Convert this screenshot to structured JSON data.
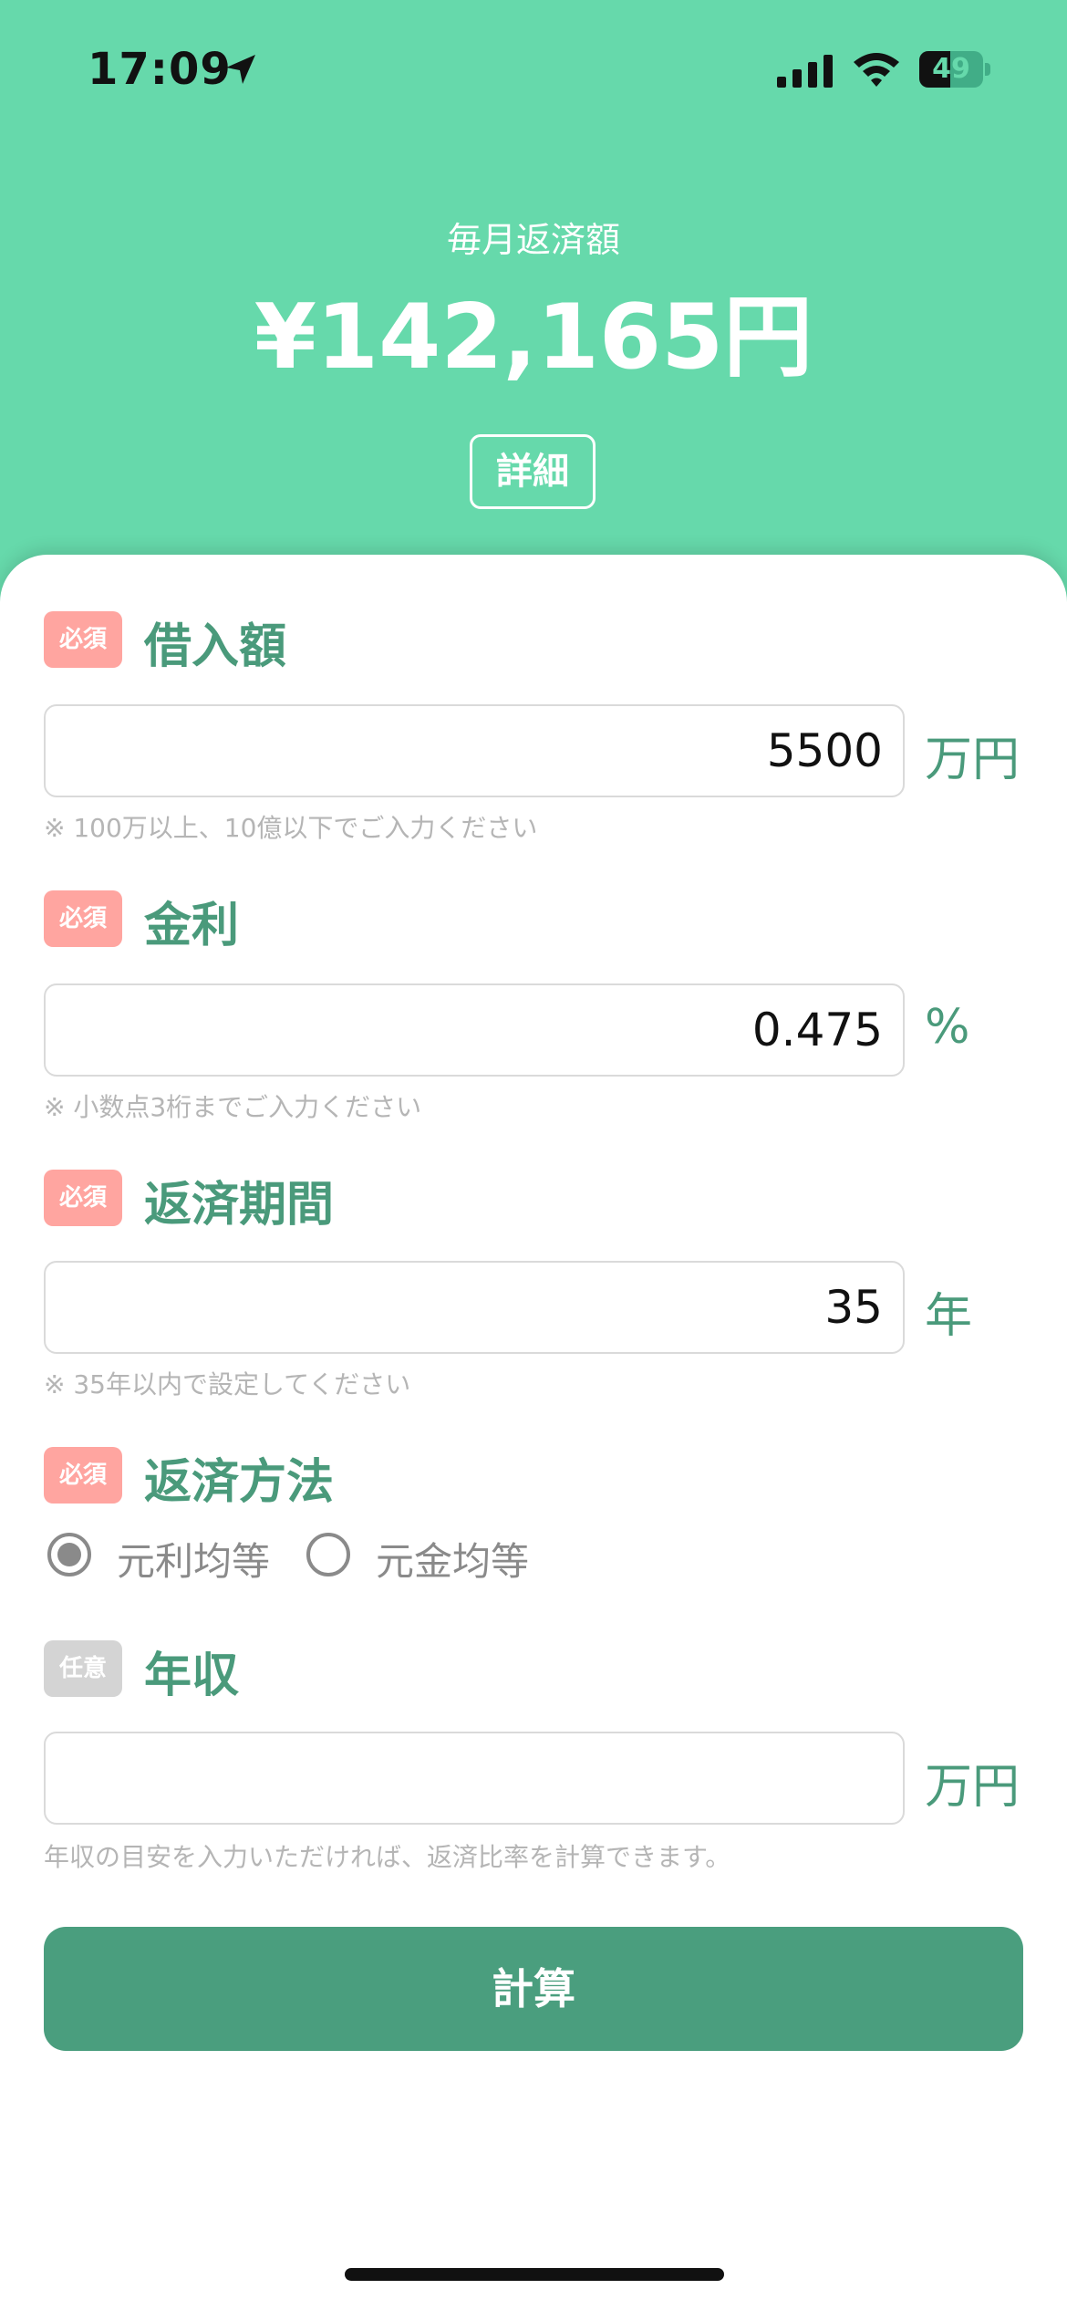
{
  "status_bar": {
    "time": "17:09",
    "battery": "49",
    "battery_level": 0.49
  },
  "hero": {
    "label": "毎月返済額",
    "amount": "¥142,165円",
    "detail_button": "詳細"
  },
  "form": {
    "loan": {
      "badge": "必須",
      "label": "借入額",
      "value": "5500",
      "unit": "万円",
      "hint": "※ 100万以上、10億以下でご入力ください"
    },
    "rate": {
      "badge": "必須",
      "label": "金利",
      "value": "0.475",
      "unit": "%",
      "hint": "※ 小数点3桁までご入力ください"
    },
    "term": {
      "badge": "必須",
      "label": "返済期間",
      "value": "35",
      "unit": "年",
      "hint": "※ 35年以内で設定してください"
    },
    "method": {
      "badge": "必須",
      "label": "返済方法",
      "options": [
        "元利均等",
        "元金均等"
      ],
      "selected": "元利均等"
    },
    "income": {
      "badge": "任意",
      "label": "年収",
      "value": "",
      "unit": "万円",
      "hint": "年収の目安を入力いただければ、返済比率を計算できます。"
    }
  },
  "calculate_button": "計算",
  "colors": {
    "header": "#66d9ab",
    "accent": "#4a9a7b",
    "required_badge": "#ffa5a0",
    "optional_badge": "#d4d4d4",
    "button": "#4a9e7e"
  }
}
